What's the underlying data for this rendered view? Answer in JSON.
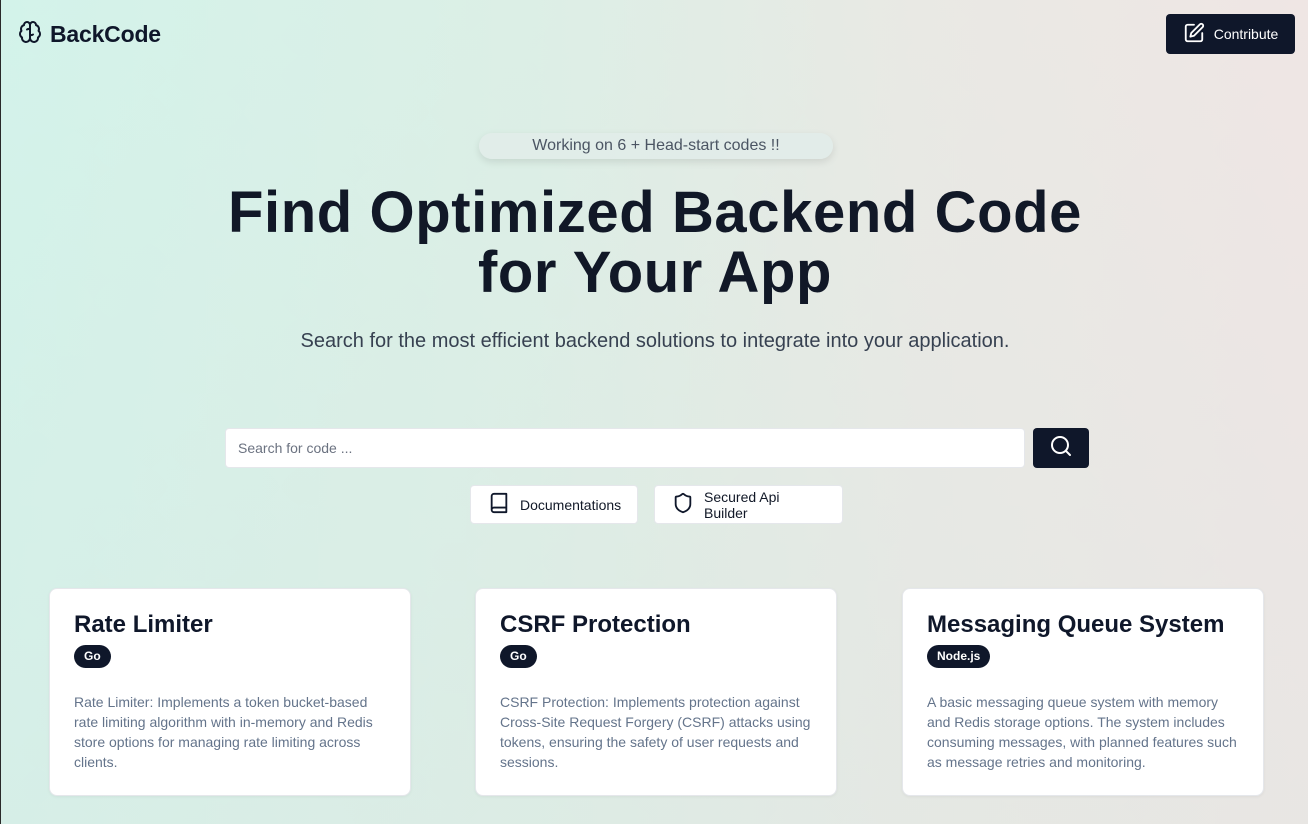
{
  "header": {
    "brand": "BackCode",
    "logo_icon": "brain-icon",
    "contribute_label": "Contribute",
    "contribute_icon": "edit-square-icon"
  },
  "hero": {
    "badge": "Working on 6 + Head-start codes !!",
    "title_line1": "Find Optimized Backend Code",
    "title_line2": "for Your App",
    "subtitle": "Search for the most efficient backend solutions to integrate into your application."
  },
  "search": {
    "placeholder": "Search for code ...",
    "value": "",
    "button_icon": "search-icon"
  },
  "quick_links": [
    {
      "label": "Documentations",
      "icon": "book-icon"
    },
    {
      "label": "Secured Api Builder",
      "icon": "shield-icon"
    }
  ],
  "cards": [
    {
      "title": "Rate Limiter",
      "badge": "Go",
      "description": "Rate Limiter: Implements a token bucket-based rate limiting algorithm with in-memory and Redis store options for managing rate limiting across clients."
    },
    {
      "title": "CSRF Protection",
      "badge": "Go",
      "description": "CSRF Protection: Implements protection against Cross-Site Request Forgery (CSRF) attacks using tokens, ensuring the safety of user requests and sessions."
    },
    {
      "title": "Messaging Queue System",
      "badge": "Node.js",
      "description": "A basic messaging queue system with memory and Redis storage options. The system includes consuming messages, with planned features such as message retries and monitoring."
    }
  ],
  "colors": {
    "primary_dark": "#0f172a",
    "text_muted": "#64748b",
    "bg_left": "#d3f3ea",
    "bg_right": "#efe6e4"
  }
}
